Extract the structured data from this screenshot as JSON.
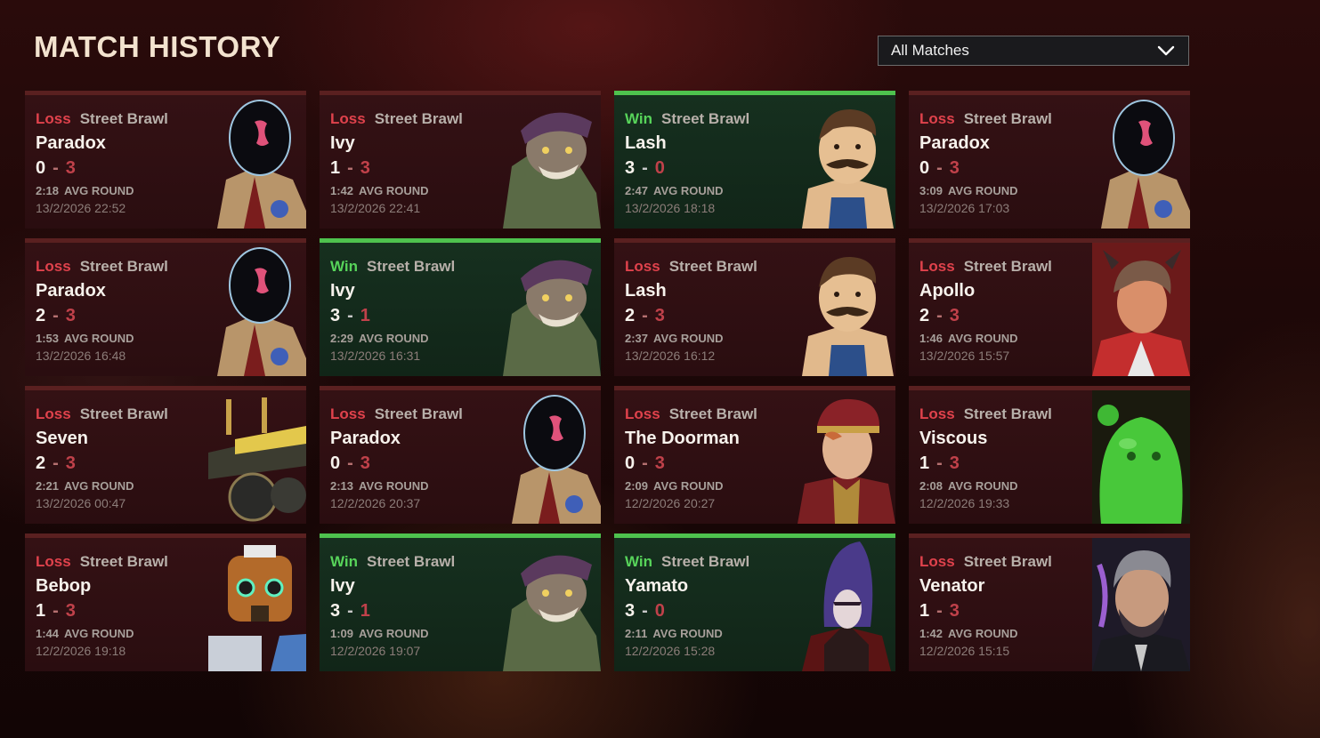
{
  "header": {
    "title": "MATCH HISTORY",
    "filter": {
      "selected": "All Matches"
    }
  },
  "matches": [
    {
      "result": "Loss",
      "mode": "Street Brawl",
      "hero": "Paradox",
      "own": "0",
      "dash": "-",
      "opp": "3",
      "avg_time": "2:18",
      "avg_label": "AVG ROUND",
      "date": "13/2/2026 22:52",
      "icon": "paradox-portrait-icon"
    },
    {
      "result": "Loss",
      "mode": "Street Brawl",
      "hero": "Ivy",
      "own": "1",
      "dash": "-",
      "opp": "3",
      "avg_time": "1:42",
      "avg_label": "AVG ROUND",
      "date": "13/2/2026 22:41",
      "icon": "ivy-portrait-icon"
    },
    {
      "result": "Win",
      "mode": "Street Brawl",
      "hero": "Lash",
      "own": "3",
      "dash": "-",
      "opp": "0",
      "avg_time": "2:47",
      "avg_label": "AVG ROUND",
      "date": "13/2/2026 18:18",
      "icon": "lash-portrait-icon"
    },
    {
      "result": "Loss",
      "mode": "Street Brawl",
      "hero": "Paradox",
      "own": "0",
      "dash": "-",
      "opp": "3",
      "avg_time": "3:09",
      "avg_label": "AVG ROUND",
      "date": "13/2/2026 17:03",
      "icon": "paradox-portrait-icon"
    },
    {
      "result": "Loss",
      "mode": "Street Brawl",
      "hero": "Paradox",
      "own": "2",
      "dash": "-",
      "opp": "3",
      "avg_time": "1:53",
      "avg_label": "AVG ROUND",
      "date": "13/2/2026 16:48",
      "icon": "paradox-portrait-icon"
    },
    {
      "result": "Win",
      "mode": "Street Brawl",
      "hero": "Ivy",
      "own": "3",
      "dash": "-",
      "opp": "1",
      "avg_time": "2:29",
      "avg_label": "AVG ROUND",
      "date": "13/2/2026 16:31",
      "icon": "ivy-portrait-icon"
    },
    {
      "result": "Loss",
      "mode": "Street Brawl",
      "hero": "Lash",
      "own": "2",
      "dash": "-",
      "opp": "3",
      "avg_time": "2:37",
      "avg_label": "AVG ROUND",
      "date": "13/2/2026 16:12",
      "icon": "lash-portrait-icon"
    },
    {
      "result": "Loss",
      "mode": "Street Brawl",
      "hero": "Apollo",
      "own": "2",
      "dash": "-",
      "opp": "3",
      "avg_time": "1:46",
      "avg_label": "AVG ROUND",
      "date": "13/2/2026 15:57",
      "icon": "apollo-portrait-icon"
    },
    {
      "result": "Loss",
      "mode": "Street Brawl",
      "hero": "Seven",
      "own": "2",
      "dash": "-",
      "opp": "3",
      "avg_time": "2:21",
      "avg_label": "AVG ROUND",
      "date": "13/2/2026 00:47",
      "icon": "seven-portrait-icon"
    },
    {
      "result": "Loss",
      "mode": "Street Brawl",
      "hero": "Paradox",
      "own": "0",
      "dash": "-",
      "opp": "3",
      "avg_time": "2:13",
      "avg_label": "AVG ROUND",
      "date": "12/2/2026 20:37",
      "icon": "paradox-portrait-icon"
    },
    {
      "result": "Loss",
      "mode": "Street Brawl",
      "hero": "The Doorman",
      "own": "0",
      "dash": "-",
      "opp": "3",
      "avg_time": "2:09",
      "avg_label": "AVG ROUND",
      "date": "12/2/2026 20:27",
      "icon": "doorman-portrait-icon"
    },
    {
      "result": "Loss",
      "mode": "Street Brawl",
      "hero": "Viscous",
      "own": "1",
      "dash": "-",
      "opp": "3",
      "avg_time": "2:08",
      "avg_label": "AVG ROUND",
      "date": "12/2/2026 19:33",
      "icon": "viscous-portrait-icon"
    },
    {
      "result": "Loss",
      "mode": "Street Brawl",
      "hero": "Bebop",
      "own": "1",
      "dash": "-",
      "opp": "3",
      "avg_time": "1:44",
      "avg_label": "AVG ROUND",
      "date": "12/2/2026 19:18",
      "icon": "bebop-portrait-icon"
    },
    {
      "result": "Win",
      "mode": "Street Brawl",
      "hero": "Ivy",
      "own": "3",
      "dash": "-",
      "opp": "1",
      "avg_time": "1:09",
      "avg_label": "AVG ROUND",
      "date": "12/2/2026 19:07",
      "icon": "ivy-portrait-icon"
    },
    {
      "result": "Win",
      "mode": "Street Brawl",
      "hero": "Yamato",
      "own": "3",
      "dash": "-",
      "opp": "0",
      "avg_time": "2:11",
      "avg_label": "AVG ROUND",
      "date": "12/2/2026 15:28",
      "icon": "yamato-portrait-icon"
    },
    {
      "result": "Loss",
      "mode": "Street Brawl",
      "hero": "Venator",
      "own": "1",
      "dash": "-",
      "opp": "3",
      "avg_time": "1:42",
      "avg_label": "AVG ROUND",
      "date": "12/2/2026 15:15",
      "icon": "venator-portrait-icon"
    }
  ],
  "colors": {
    "win": "#57d45a",
    "loss": "#e0424c",
    "win_bar": "#4ec24e",
    "loss_bar": "#5a2020",
    "title": "#f3e3cf"
  }
}
